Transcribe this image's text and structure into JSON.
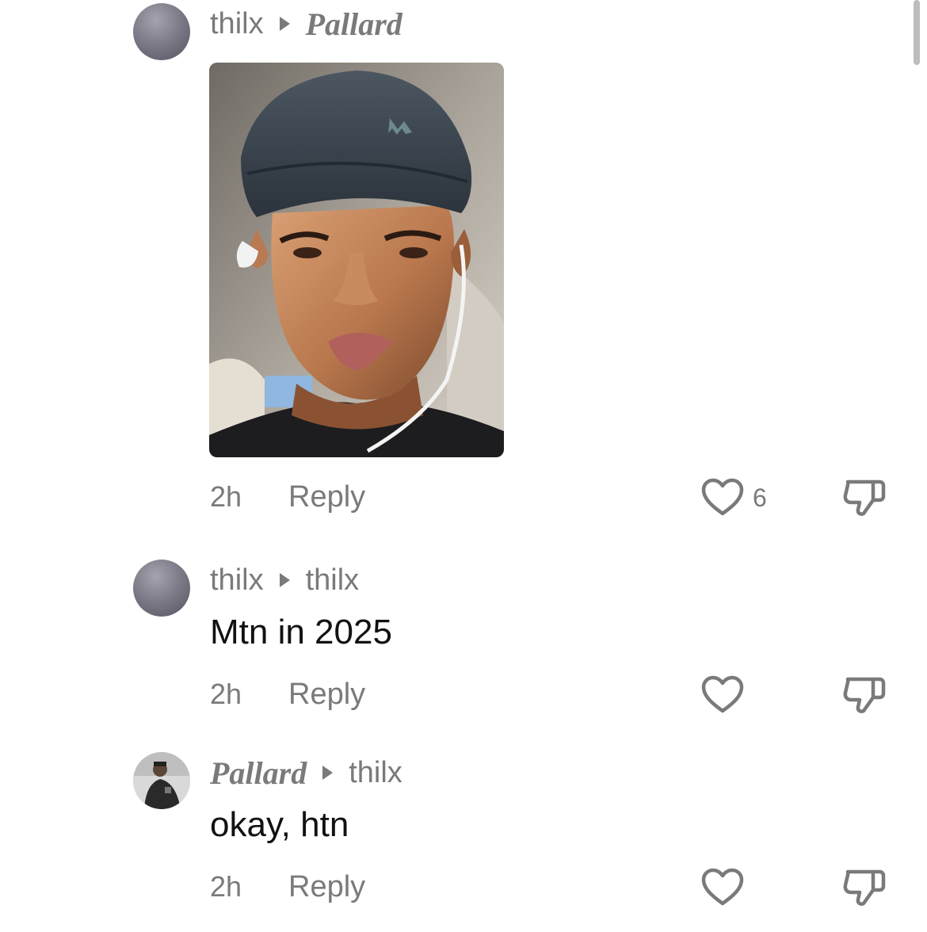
{
  "comments": [
    {
      "author": "thilx",
      "reply_to": "Pallard",
      "text": "",
      "has_image": true,
      "time": "2h",
      "reply_label": "Reply",
      "likes": "6"
    },
    {
      "author": "thilx",
      "reply_to": "thilx",
      "text": "Mtn in 2025",
      "has_image": false,
      "time": "2h",
      "reply_label": "Reply",
      "likes": ""
    },
    {
      "author": "Pallard",
      "reply_to": "thilx",
      "text": "okay, htn",
      "has_image": false,
      "time": "2h",
      "reply_label": "Reply",
      "likes": ""
    }
  ],
  "icons": {
    "like": "heart-outline-icon",
    "dislike": "thumbs-down-outline-icon",
    "reply_arrow": "caret-right-icon"
  },
  "colors": {
    "meta_text": "#7a7a7a",
    "body_text": "#111111",
    "background": "#ffffff"
  }
}
